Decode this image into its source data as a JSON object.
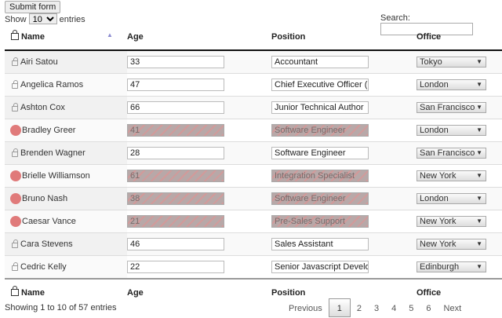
{
  "submit_label": "Submit form",
  "length": {
    "prefix": "Show",
    "value": "10",
    "suffix": "entries"
  },
  "search": {
    "label": "Search:",
    "value": ""
  },
  "columns": [
    "Name",
    "Age",
    "Position",
    "Office"
  ],
  "rows": [
    {
      "name": "Airi Satou",
      "age": "33",
      "position": "Accountant",
      "office": "Tokyo",
      "locked": false
    },
    {
      "name": "Angelica Ramos",
      "age": "47",
      "position": "Chief Executive Officer (CEO)",
      "office": "London",
      "locked": false
    },
    {
      "name": "Ashton Cox",
      "age": "66",
      "position": "Junior Technical Author",
      "office": "San Francisco",
      "locked": false
    },
    {
      "name": "Bradley Greer",
      "age": "41",
      "position": "Software Engineer",
      "office": "London",
      "locked": true
    },
    {
      "name": "Brenden Wagner",
      "age": "28",
      "position": "Software Engineer",
      "office": "San Francisco",
      "locked": false
    },
    {
      "name": "Brielle Williamson",
      "age": "61",
      "position": "Integration Specialist",
      "office": "New York",
      "locked": true
    },
    {
      "name": "Bruno Nash",
      "age": "38",
      "position": "Software Engineer",
      "office": "London",
      "locked": true
    },
    {
      "name": "Caesar Vance",
      "age": "21",
      "position": "Pre-Sales Support",
      "office": "New York",
      "locked": true
    },
    {
      "name": "Cara Stevens",
      "age": "46",
      "position": "Sales Assistant",
      "office": "New York",
      "locked": false
    },
    {
      "name": "Cedric Kelly",
      "age": "22",
      "position": "Senior Javascript Developer",
      "office": "Edinburgh",
      "locked": false
    }
  ],
  "info": "Showing 1 to 10 of 57 entries",
  "pagination": {
    "previous": "Previous",
    "pages": [
      "1",
      "2",
      "3",
      "4",
      "5",
      "6"
    ],
    "current": "1",
    "next": "Next"
  }
}
